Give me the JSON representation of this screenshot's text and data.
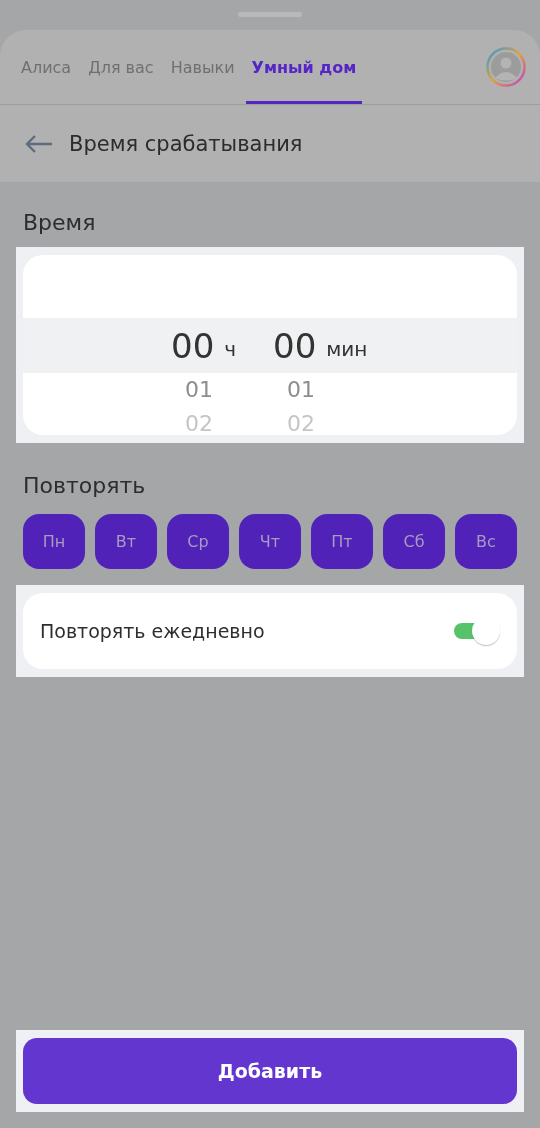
{
  "tabs": [
    {
      "label": "Алиса",
      "selected": false
    },
    {
      "label": "Для вас",
      "selected": false
    },
    {
      "label": "Навыки",
      "selected": false
    },
    {
      "label": "Умный дом",
      "selected": true
    }
  ],
  "header": {
    "title": "Время срабатывания"
  },
  "time_section": {
    "title": "Время",
    "hours": {
      "selected": "00",
      "unit": "ч",
      "below": [
        "01",
        "02"
      ]
    },
    "minutes": {
      "selected": "00",
      "unit": "мин",
      "below": [
        "01",
        "02"
      ]
    }
  },
  "repeat_section": {
    "title": "Повторять",
    "days": [
      {
        "label": "Пн",
        "selected": true
      },
      {
        "label": "Вт",
        "selected": true
      },
      {
        "label": "Ср",
        "selected": true
      },
      {
        "label": "Чт",
        "selected": true
      },
      {
        "label": "Пт",
        "selected": true
      },
      {
        "label": "Сб",
        "selected": true
      },
      {
        "label": "Вс",
        "selected": true
      }
    ]
  },
  "daily": {
    "label": "Повторять ежедневно",
    "on": true
  },
  "add_button": {
    "label": "Добавить"
  }
}
